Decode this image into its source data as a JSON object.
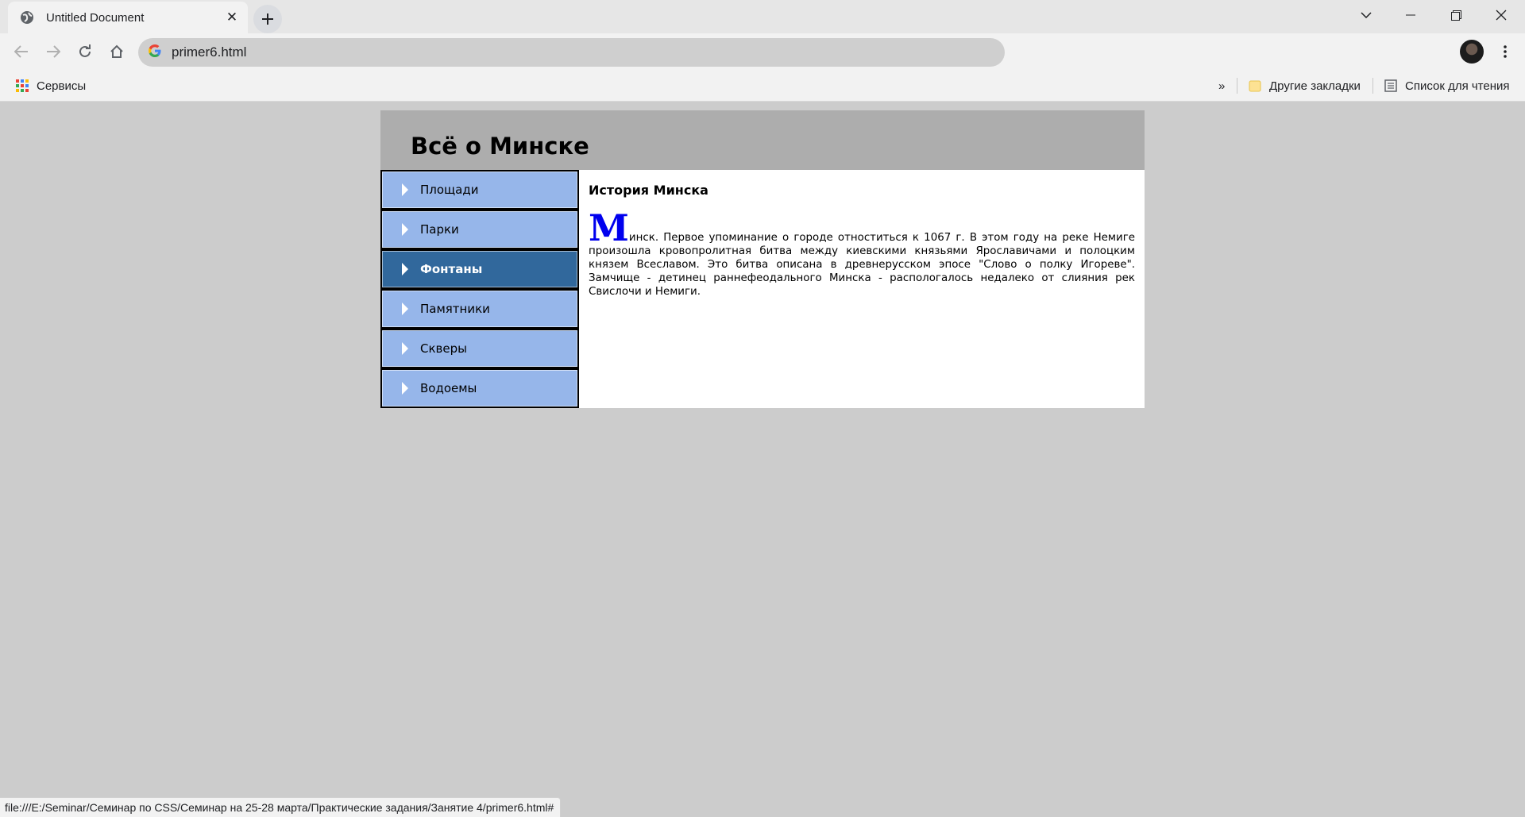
{
  "browser": {
    "tab_title": "Untitled Document",
    "url": "primer6.html",
    "bookmarks": {
      "apps_label": "Сервисы",
      "other_label": "Другие закладки",
      "reading_list_label": "Список для чтения",
      "overflow": "»"
    },
    "status_url": "file:///E:/Seminar/Семинар по CSS/Семинар на 25-28 марта/Практические задания/Занятие 4/primer6.html#"
  },
  "site": {
    "title": "Всё о Минске",
    "menu": [
      {
        "label": "Площади",
        "active": false
      },
      {
        "label": "Парки",
        "active": false
      },
      {
        "label": "Фонтаны",
        "active": true
      },
      {
        "label": "Памятники",
        "active": false
      },
      {
        "label": "Скверы",
        "active": false
      },
      {
        "label": "Водоемы",
        "active": false
      }
    ],
    "article": {
      "heading": "История Минска",
      "dropcap": "М",
      "text": "инск. Первое упоминание о городе отноститься к 1067 г. В этом году на реке Немиге произошла кровопролитная битва между киевскими князьями Ярославичами и полоцким князем Всеславом. Это битва описана в древнерусском эпосе \"Слово о полку Игореве\". Замчище - детинец раннефеодального Минска - распологалось недалеко от слияния рек Свислочи и Немиги."
    }
  },
  "colors": {
    "menu_bg": "#96b6ea",
    "menu_active_bg": "#31689c",
    "header_bg": "#adadad",
    "dropcap": "#0000ee"
  }
}
